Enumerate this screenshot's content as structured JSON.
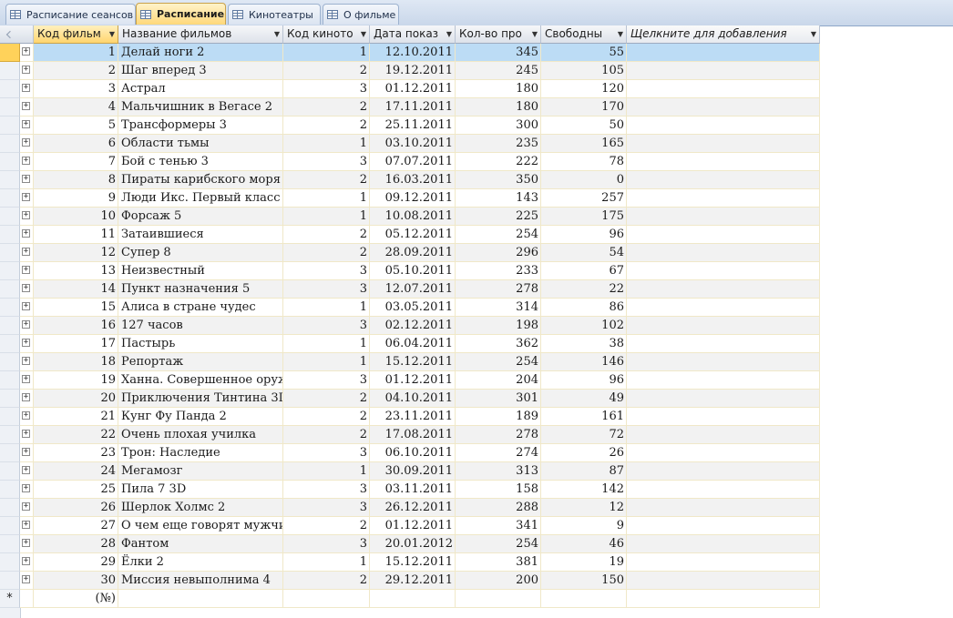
{
  "tabs": [
    {
      "label": "Расписание сеансов",
      "active": false
    },
    {
      "label": "Расписание",
      "active": true
    },
    {
      "label": "Кинотеатры",
      "active": false
    },
    {
      "label": "О фильме",
      "active": false
    }
  ],
  "columns": [
    {
      "label": "Код фильм",
      "dropdown": true
    },
    {
      "label": "Название фильмов",
      "dropdown": true
    },
    {
      "label": "Код киното",
      "dropdown": true
    },
    {
      "label": "Дата показ",
      "dropdown": true
    },
    {
      "label": "Кол-во про",
      "dropdown": true
    },
    {
      "label": "Свободны",
      "dropdown": true
    },
    {
      "label": "Щелкните для добавления",
      "dropdown": true
    }
  ],
  "rows": [
    [
      "1",
      "Делай ноги 2",
      "1",
      "12.10.2011",
      "345",
      "55"
    ],
    [
      "2",
      "Шаг вперед 3",
      "2",
      "19.12.2011",
      "245",
      "105"
    ],
    [
      "3",
      "Астрал",
      "3",
      "01.12.2011",
      "180",
      "120"
    ],
    [
      "4",
      "Мальчишник в Вегасе 2",
      "2",
      "17.11.2011",
      "180",
      "170"
    ],
    [
      "5",
      "Трансформеры 3",
      "2",
      "25.11.2011",
      "300",
      "50"
    ],
    [
      "6",
      "Области тьмы",
      "1",
      "03.10.2011",
      "235",
      "165"
    ],
    [
      "7",
      "Бой с тенью 3",
      "3",
      "07.07.2011",
      "222",
      "78"
    ],
    [
      "8",
      "Пираты карибского моря",
      "2",
      "16.03.2011",
      "350",
      "0"
    ],
    [
      "9",
      "Люди Икс. Первый класс",
      "1",
      "09.12.2011",
      "143",
      "257"
    ],
    [
      "10",
      "Форсаж 5",
      "1",
      "10.08.2011",
      "225",
      "175"
    ],
    [
      "11",
      "Затаившиеся",
      "2",
      "05.12.2011",
      "254",
      "96"
    ],
    [
      "12",
      "Супер 8",
      "2",
      "28.09.2011",
      "296",
      "54"
    ],
    [
      "13",
      "Неизвестный",
      "3",
      "05.10.2011",
      "233",
      "67"
    ],
    [
      "14",
      "Пункт назначения 5",
      "3",
      "12.07.2011",
      "278",
      "22"
    ],
    [
      "15",
      "Алиса в стране чудес",
      "1",
      "03.05.2011",
      "314",
      "86"
    ],
    [
      "16",
      "127 часов",
      "3",
      "02.12.2011",
      "198",
      "102"
    ],
    [
      "17",
      "Пастырь",
      "1",
      "06.04.2011",
      "362",
      "38"
    ],
    [
      "18",
      "Репортаж",
      "1",
      "15.12.2011",
      "254",
      "146"
    ],
    [
      "19",
      "Ханна. Совершенное оруж",
      "3",
      "01.12.2011",
      "204",
      "96"
    ],
    [
      "20",
      "Приключения Тинтина 3D",
      "2",
      "04.10.2011",
      "301",
      "49"
    ],
    [
      "21",
      "Кунг Фу Панда 2",
      "2",
      "23.11.2011",
      "189",
      "161"
    ],
    [
      "22",
      "Очень плохая училка",
      "2",
      "17.08.2011",
      "278",
      "72"
    ],
    [
      "23",
      "Трон: Наследие",
      "3",
      "06.10.2011",
      "274",
      "26"
    ],
    [
      "24",
      "Мегамозг",
      "1",
      "30.09.2011",
      "313",
      "87"
    ],
    [
      "25",
      "Пила 7 3D",
      "3",
      "03.11.2011",
      "158",
      "142"
    ],
    [
      "26",
      "Шерлок Холмс 2",
      "3",
      "26.12.2011",
      "288",
      "12"
    ],
    [
      "27",
      "О чем еще говорят мужчи",
      "2",
      "01.12.2011",
      "341",
      "9"
    ],
    [
      "28",
      "Фантом",
      "3",
      "20.01.2012",
      "254",
      "46"
    ],
    [
      "29",
      "Ёлки 2",
      "1",
      "15.12.2011",
      "381",
      "19"
    ],
    [
      "30",
      "Миссия невыполнима 4",
      "2",
      "29.12.2011",
      "200",
      "150"
    ]
  ],
  "selected_row": 0,
  "new_row": {
    "marker": "*",
    "placeholder": "(№)"
  },
  "icons": {
    "tab": "table-icon",
    "expand": "plus-expand-icon",
    "dropdown": "dropdown-arrow-icon"
  }
}
